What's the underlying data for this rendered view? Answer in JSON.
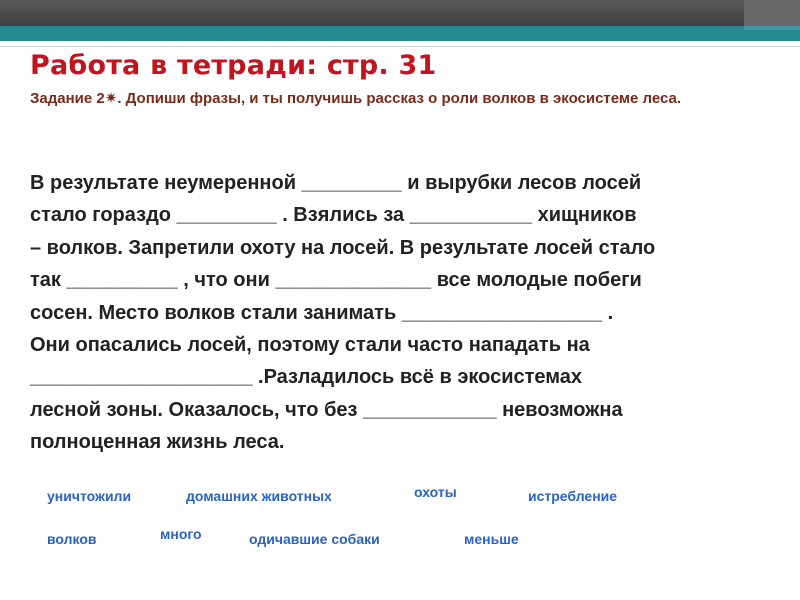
{
  "title": "Работа в тетради: стр. 31",
  "task": {
    "prefix": "Задание 2",
    "star": "✷",
    "text": ". Допиши фразы,  и ты получишь рассказ о роли волков в экосистеме  леса."
  },
  "story": {
    "lines": [
      "В результате неумеренной _________ и вырубки лесов лосей",
      "стало гораздо _________ . Взялись за ___________ хищников",
      "– волков. Запретили охоту на лосей. В результате лосей стало",
      "так __________ , что они ______________ все молодые побеги",
      "сосен. Место волков стали занимать __________________ .",
      "Они опасались лосей, поэтому стали часто нападать на",
      "____________________ .Разладилось всё в экосистемах",
      "лесной зоны. Оказалось, что без ____________ невозможна",
      "полноценная жизнь леса."
    ]
  },
  "word_bank": {
    "uničtožili": "уничтожили",
    "domashnikh": "домашних животных",
    "okhoty": "охоты",
    "istreblenie": "истребление",
    "volkov": "волков",
    "mnogo": "много",
    "odichavshie": "одичавшие собаки",
    "menshe": "меньше"
  },
  "colors": {
    "title": "#c0151f",
    "task": "#7a2a1a",
    "story": "#222222",
    "word_bank": "#2a62c6",
    "header_dark": "#4a4a4a",
    "header_teal": "#28888f"
  }
}
